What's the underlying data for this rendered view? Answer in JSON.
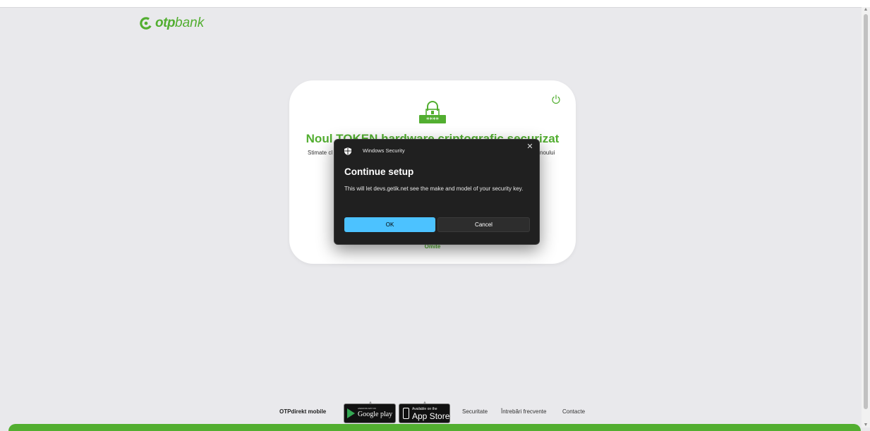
{
  "brand": {
    "name_bold": "otp",
    "name_rest": "bank",
    "color": "#52ae30"
  },
  "card": {
    "title": "Noul TOKEN hardware criptografic securizat",
    "text_left": "Stimate cl",
    "text_right": "noului",
    "skip_label": "Omite"
  },
  "dialog": {
    "app_name": "Windows Security",
    "close_glyph": "✕",
    "heading": "Continue setup",
    "body": "This will let devs.getik.net see the make and model of your security key.",
    "ok_label": "OK",
    "cancel_label": "Cancel",
    "accent": "#4cc2ff"
  },
  "footer": {
    "brand_label": "OTPdirekt mobile",
    "google": {
      "small": "ANDROID APP ON",
      "big": "Google play"
    },
    "apple": {
      "small": "Available on the",
      "big": "App Store"
    },
    "links": [
      "Securitate",
      "Întrebări frecvente",
      "Contacte"
    ]
  }
}
